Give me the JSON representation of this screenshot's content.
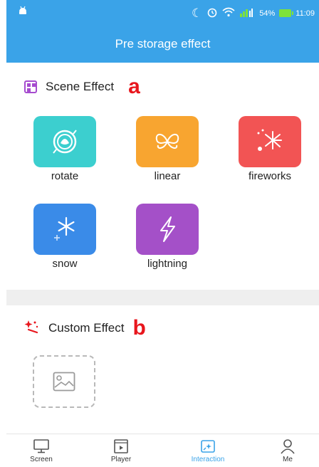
{
  "status_bar": {
    "battery": "54%",
    "time": "11:09"
  },
  "header": {
    "title": "Pre storage effect"
  },
  "scene_section": {
    "title": "Scene Effect",
    "marker": "a",
    "items": [
      {
        "label": "rotate",
        "color": "#3ccfcf"
      },
      {
        "label": "linear",
        "color": "#f8a530"
      },
      {
        "label": "fireworks",
        "color": "#f25454"
      },
      {
        "label": "snow",
        "color": "#3a8be8"
      },
      {
        "label": "lightning",
        "color": "#a450c8"
      }
    ]
  },
  "custom_section": {
    "title": "Custom Effect",
    "marker": "b"
  },
  "tabs": [
    {
      "label": "Screen",
      "icon": "monitor-icon"
    },
    {
      "label": "Player",
      "icon": "player-icon"
    },
    {
      "label": "Interaction",
      "icon": "interaction-icon",
      "active": true
    },
    {
      "label": "Me",
      "icon": "person-icon"
    }
  ],
  "colors": {
    "accent": "#3aa3e8",
    "marker": "#e8161d"
  }
}
